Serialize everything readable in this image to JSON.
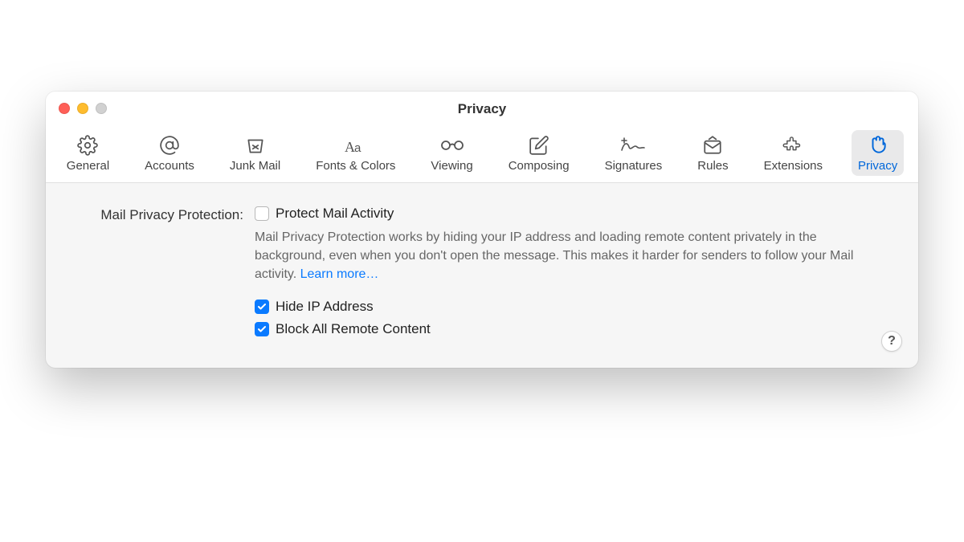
{
  "window": {
    "title": "Privacy"
  },
  "tabs": [
    {
      "label": "General"
    },
    {
      "label": "Accounts"
    },
    {
      "label": "Junk Mail"
    },
    {
      "label": "Fonts & Colors"
    },
    {
      "label": "Viewing"
    },
    {
      "label": "Composing"
    },
    {
      "label": "Signatures"
    },
    {
      "label": "Rules"
    },
    {
      "label": "Extensions"
    },
    {
      "label": "Privacy"
    }
  ],
  "section": {
    "heading": "Mail Privacy Protection:",
    "protect_label": "Protect Mail Activity",
    "desc": "Mail Privacy Protection works by hiding your IP address and loading remote content privately in the background, even when you don't open the message. This makes it harder for senders to follow your Mail activity. ",
    "learn_more": "Learn more…",
    "hide_ip_label": "Hide IP Address",
    "block_remote_label": "Block All Remote Content"
  },
  "help": "?"
}
